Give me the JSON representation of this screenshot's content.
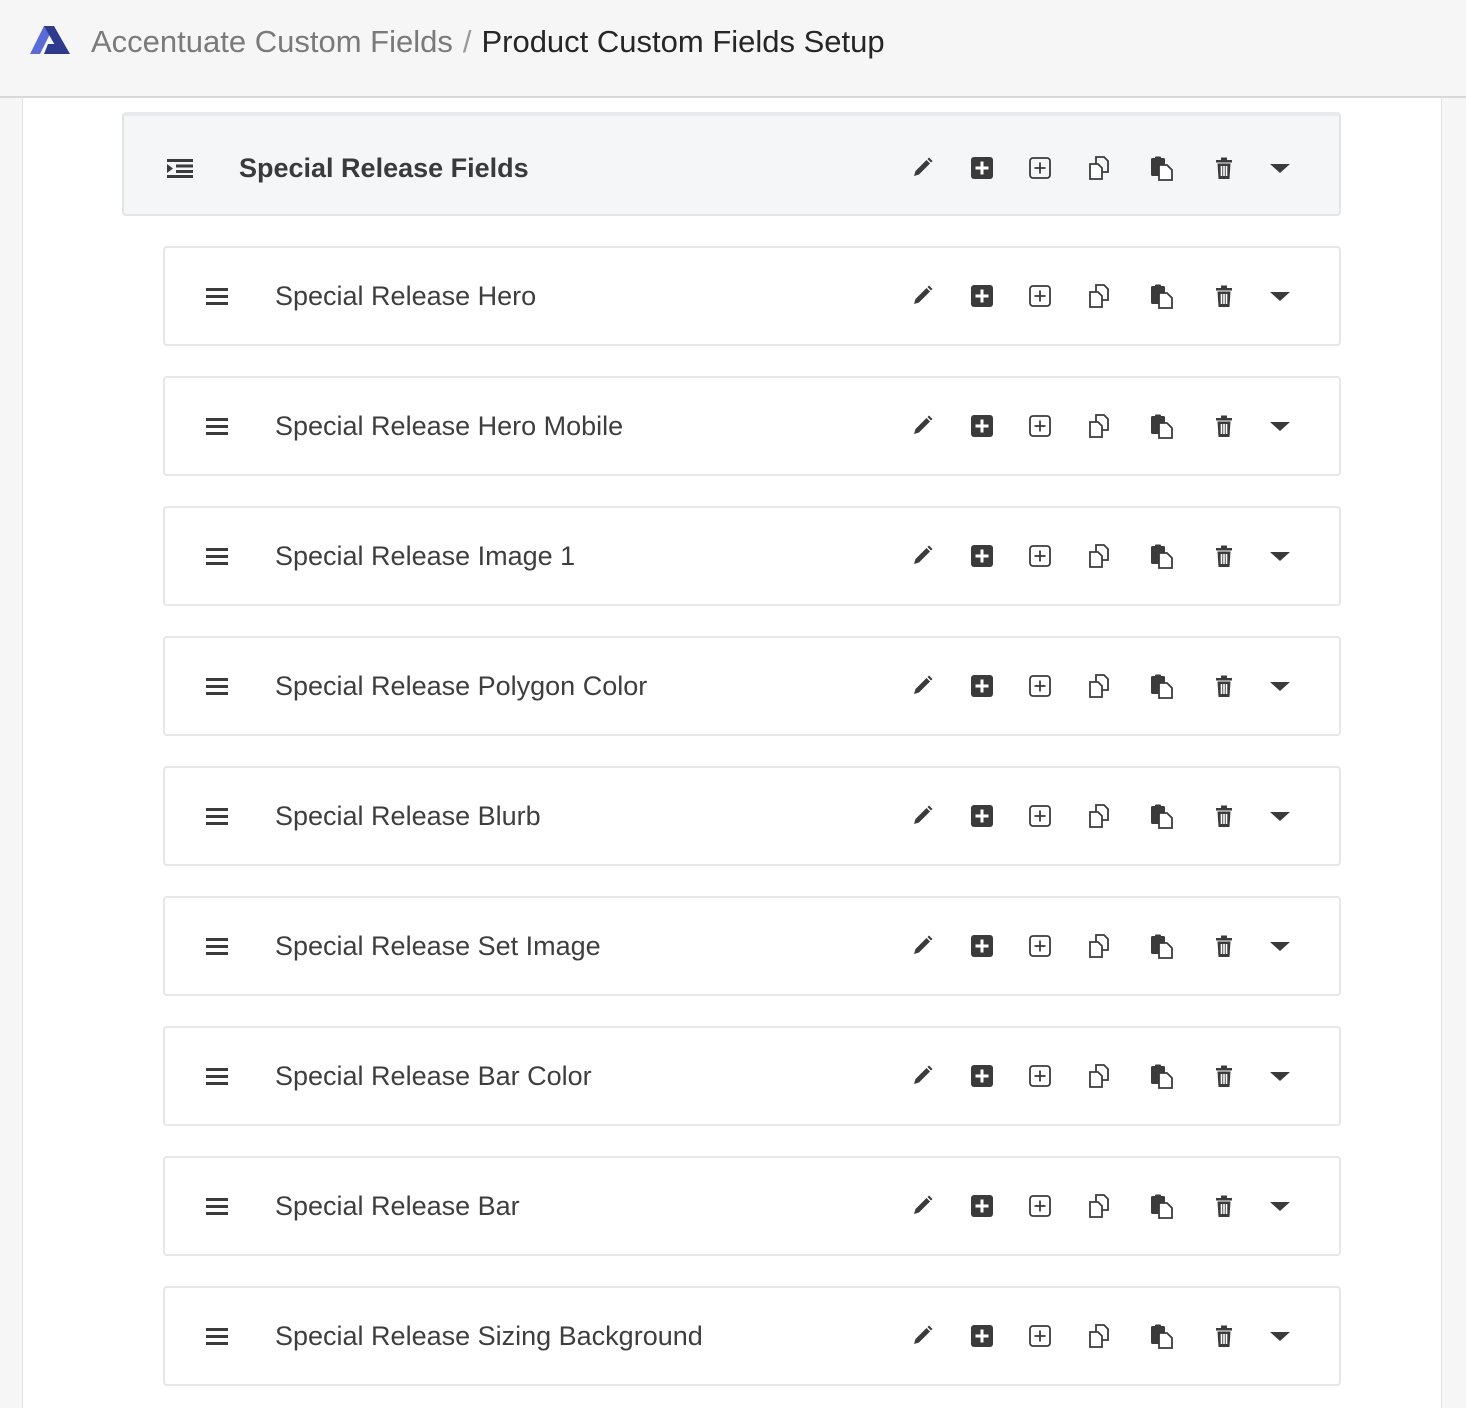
{
  "header": {
    "app_name": "Accentuate Custom Fields",
    "separator": "/",
    "page_title": "Product Custom Fields Setup"
  },
  "colors": {
    "logo_primary": "#2e3a8c",
    "logo_secondary": "#5b6bd6",
    "icon": "#3b3b3b"
  },
  "group": {
    "label": "Special Release Fields",
    "icon": "indent-list-icon"
  },
  "fields": [
    {
      "label": "Special Release Hero"
    },
    {
      "label": "Special Release Hero Mobile"
    },
    {
      "label": "Special Release Image 1"
    },
    {
      "label": "Special Release Polygon Color"
    },
    {
      "label": "Special Release Blurb"
    },
    {
      "label": "Special Release Set Image"
    },
    {
      "label": "Special Release Bar Color"
    },
    {
      "label": "Special Release Bar"
    },
    {
      "label": "Special Release Sizing Background"
    }
  ],
  "row_actions": [
    {
      "name": "edit",
      "icon": "pencil-icon"
    },
    {
      "name": "add",
      "icon": "plus-square-filled-icon"
    },
    {
      "name": "add-inside",
      "icon": "plus-square-outline-icon"
    },
    {
      "name": "copy",
      "icon": "copy-icon"
    },
    {
      "name": "paste",
      "icon": "paste-icon"
    },
    {
      "name": "delete",
      "icon": "trash-icon"
    },
    {
      "name": "expand",
      "icon": "caret-down-icon"
    }
  ]
}
